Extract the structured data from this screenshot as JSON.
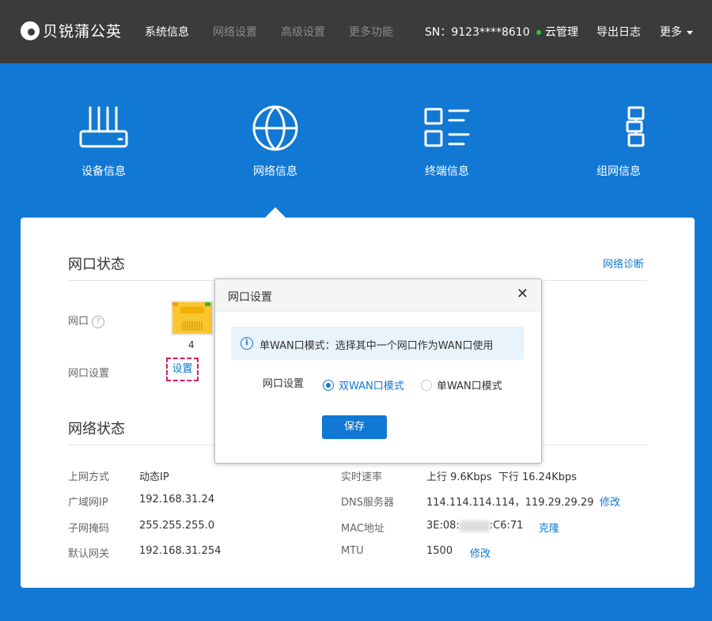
{
  "brand": {
    "name": "贝锐蒲公英"
  },
  "nav": [
    {
      "label": "系统信息",
      "active": true
    },
    {
      "label": "网络设置",
      "active": false
    },
    {
      "label": "高级设置",
      "active": false
    },
    {
      "label": "更多功能",
      "active": false
    }
  ],
  "topright": {
    "sn": "SN：9123****8610",
    "cloud": "云管理",
    "export_log": "导出日志",
    "more": "更多"
  },
  "features": [
    {
      "label": "设备信息",
      "icon": "router-icon"
    },
    {
      "label": "网络信息",
      "icon": "globe-icon"
    },
    {
      "label": "终端信息",
      "icon": "list-grid-icon"
    },
    {
      "label": "组网信息",
      "icon": "network-topology-icon"
    }
  ],
  "port_status": {
    "title": "网口状态",
    "diagnose_link": "网络诊断",
    "port_label": "网口",
    "help": "?",
    "port_number": "4",
    "port_setting_label": "网口设置",
    "port_setting_link": "设置"
  },
  "network_status": {
    "title": "网络状态",
    "left": [
      {
        "label": "上网方式",
        "value": "动态IP"
      },
      {
        "label": "广域网IP",
        "value": "192.168.31.24"
      },
      {
        "label": "子网掩码",
        "value": "255.255.255.0"
      },
      {
        "label": "默认网关",
        "value": "192.168.31.254"
      }
    ],
    "right": [
      {
        "label": "实时速率",
        "value": "上行 9.6Kbps  下行 16.24Kbps",
        "action": ""
      },
      {
        "label": "DNS服务器",
        "value": "114.114.114.114，119.29.29.29",
        "action": "修改"
      },
      {
        "label": "MAC地址",
        "value": "3E:08:",
        "value_end": ":C6:71",
        "action": "克隆"
      },
      {
        "label": "MTU",
        "value": "1500",
        "action": "修改"
      }
    ]
  },
  "modal": {
    "title": "网口设置",
    "close": "✕",
    "info": "单WAN口模式：选择其中一个网口作为WAN口使用",
    "field_label": "网口设置",
    "options": [
      {
        "label": "双WAN口模式",
        "selected": true
      },
      {
        "label": "单WAN口模式",
        "selected": false
      }
    ],
    "save": "保存"
  },
  "colors": {
    "primary": "#1178D4",
    "topbar": "#3B3B3B",
    "highlight": "#d81b60"
  }
}
